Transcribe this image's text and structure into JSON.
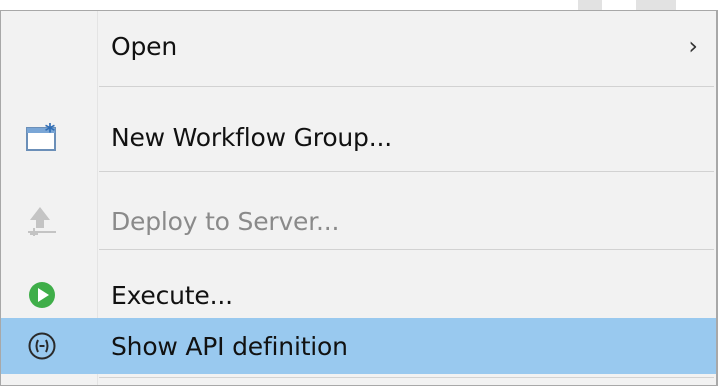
{
  "menu": {
    "items": [
      {
        "label": "Open",
        "icon": "none",
        "has_submenu": true,
        "submenu_glyph": "›",
        "state": "normal"
      },
      {
        "label": "New Workflow Group...",
        "icon": "new-window-star-icon",
        "state": "normal"
      },
      {
        "label": "Deploy to Server...",
        "icon": "deploy-arrow-icon",
        "state": "disabled"
      },
      {
        "label": "Execute...",
        "icon": "play-circle-icon",
        "state": "normal"
      },
      {
        "label": "Show API definition",
        "icon": "api-brackets-icon",
        "state": "highlighted"
      }
    ]
  },
  "colors": {
    "menu_background": "#f2f2f2",
    "highlight": "#99c9ef",
    "border": "#a8a8a8",
    "separator": "#d2d2d2",
    "disabled_text": "#8a8a8a",
    "execute_green": "#3fae49",
    "new_group_blue": "#2f6db5"
  }
}
